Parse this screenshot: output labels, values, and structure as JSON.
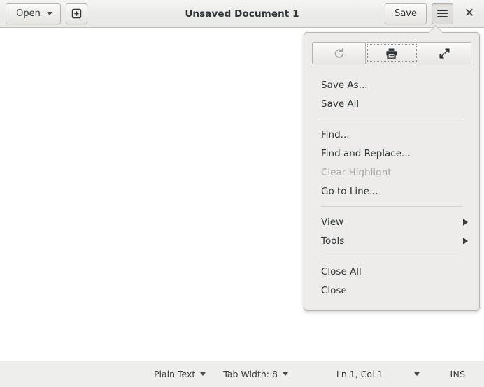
{
  "window": {
    "title": "Unsaved Document 1"
  },
  "headerbar": {
    "open_label": "Open",
    "open_icon": "chevron-down-icon",
    "new_document_icon": "new-document-icon",
    "save_label": "Save",
    "menu_icon": "hamburger-menu-icon",
    "close_icon": "close-icon",
    "close_glyph": "✕"
  },
  "editor": {
    "content": ""
  },
  "menu": {
    "toolbuttons": [
      {
        "name": "redo-button",
        "icon": "redo-icon",
        "state": "disabled"
      },
      {
        "name": "print-button",
        "icon": "print-icon",
        "state": "focused"
      },
      {
        "name": "fullscreen-button",
        "icon": "fullscreen-icon",
        "state": "normal"
      }
    ],
    "items": [
      {
        "label": "Save As...",
        "type": "item",
        "enabled": true
      },
      {
        "label": "Save All",
        "type": "item",
        "enabled": true
      },
      {
        "label": "",
        "type": "separator",
        "enabled": true
      },
      {
        "label": "Find...",
        "type": "item",
        "enabled": true
      },
      {
        "label": "Find and Replace...",
        "type": "item",
        "enabled": true
      },
      {
        "label": "Clear Highlight",
        "type": "item",
        "enabled": false
      },
      {
        "label": "Go to Line...",
        "type": "item",
        "enabled": true
      },
      {
        "label": "",
        "type": "separator",
        "enabled": true
      },
      {
        "label": "View",
        "type": "submenu",
        "enabled": true
      },
      {
        "label": "Tools",
        "type": "submenu",
        "enabled": true
      },
      {
        "label": "",
        "type": "separator",
        "enabled": true
      },
      {
        "label": "Close All",
        "type": "item",
        "enabled": true
      },
      {
        "label": "Close",
        "type": "item",
        "enabled": true
      }
    ]
  },
  "statusbar": {
    "language": "Plain Text",
    "tab_width": "Tab Width: 8",
    "position": "Ln 1, Col 1",
    "insert_mode": "INS"
  },
  "colors": {
    "headerbar_bg": "#ebebe9",
    "editor_bg": "#ffffff",
    "statusbar_bg": "#eeeeec",
    "popover_bg": "#edecea",
    "text": "#2e3436",
    "text_disabled": "#a6a6a3",
    "border": "#b8b5b0"
  }
}
